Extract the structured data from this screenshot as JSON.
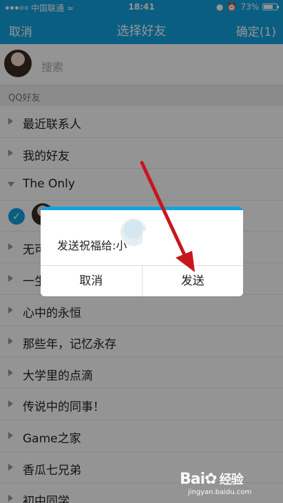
{
  "status_bar": {
    "carrier": "中国联通",
    "time": "18:41",
    "battery": "73%",
    "battery_level": 0.73
  },
  "nav": {
    "cancel": "取消",
    "title": "选择好友",
    "confirm": "确定(1)"
  },
  "search": {
    "placeholder": "搜索"
  },
  "section": {
    "header": "QQ好友"
  },
  "groups": [
    {
      "label": "最近联系人",
      "expanded": false
    },
    {
      "label": "我的好友",
      "expanded": false
    },
    {
      "label": "The Only",
      "expanded": true
    },
    {
      "label": "无可",
      "expanded": false
    },
    {
      "label": "一生",
      "expanded": false
    },
    {
      "label": "心中的永恒",
      "expanded": false
    },
    {
      "label": "那些年，记忆永存",
      "expanded": false
    },
    {
      "label": "大学里的点滴",
      "expanded": false
    },
    {
      "label": "传说中的同事！",
      "expanded": false
    },
    {
      "label": "Game之家",
      "expanded": false
    },
    {
      "label": "香瓜七兄弟",
      "expanded": false
    },
    {
      "label": "初中同学",
      "expanded": false
    }
  ],
  "dialog": {
    "message": "发送祝福给:小",
    "cancel": "取消",
    "send": "发送"
  },
  "watermark": {
    "brand": "Bai",
    "brand_suffix": "经验",
    "url": "jingyan.baidu.com"
  },
  "colors": {
    "accent": "#12a3e0",
    "arrow": "#c8161d"
  }
}
